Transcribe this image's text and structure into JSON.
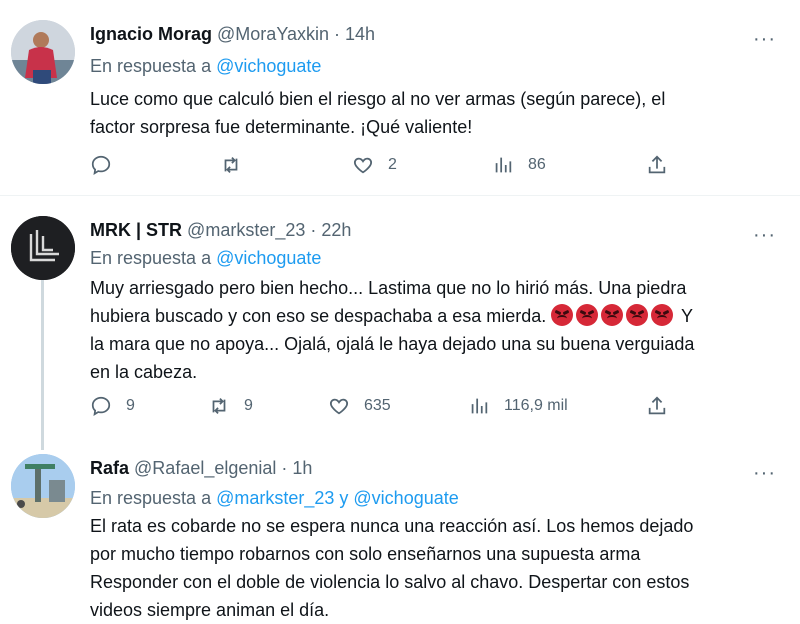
{
  "tweets": [
    {
      "name": "Ignacio Morag",
      "handle": "@MoraYaxkin",
      "time": "· 14h",
      "reply_prefix": "En respuesta a",
      "reply_mentions": "@vichoguate",
      "body_lines": [
        "Luce como que calculó bien el riesgo al no ver armas (según parece), el",
        "factor sorpresa fue determinante.  ¡Qué valiente!"
      ],
      "replies": "",
      "retweets": "",
      "likes": "2",
      "views": "86"
    },
    {
      "name": "MRK | STR",
      "handle": "@markster_23",
      "time": "· 22h",
      "reply_prefix": "En respuesta a",
      "reply_mentions": "@vichoguate",
      "body_line1": "Muy arriesgado pero bien hecho... Lastima que no lo hirió más. Una piedra",
      "body_line2_text": "hubiera buscado y con eso se despachaba a esa mierda. ",
      "body_line2_after": " Y",
      "emoji_name": "angry-face-icon",
      "emoji_count": 5,
      "body_line3": "la mara que no apoya... Ojalá, ojalá le haya dejado una su buena verguiada",
      "body_line4": "en la cabeza.",
      "replies": "9",
      "retweets": "9",
      "likes": "635",
      "views": "116,9 mil"
    },
    {
      "name": "Rafa",
      "handle": "@Rafael_elgenial",
      "time": "· 1h",
      "reply_prefix": "En respuesta a",
      "reply_mentions": "@markster_23 y @vichoguate",
      "body_lines": [
        "El rata es cobarde no se espera nunca una reacción así. Los hemos dejado",
        "por mucho tiempo robarnos con solo enseñarnos una supuesta arma",
        "Responder con el doble de violencia lo salvo al chavo. Despertar con estos",
        "videos siempre animan el día."
      ]
    }
  ],
  "more_label": "···",
  "colors": {
    "accent": "#1d9bf0",
    "muted": "#536471",
    "text": "#0f1419"
  }
}
